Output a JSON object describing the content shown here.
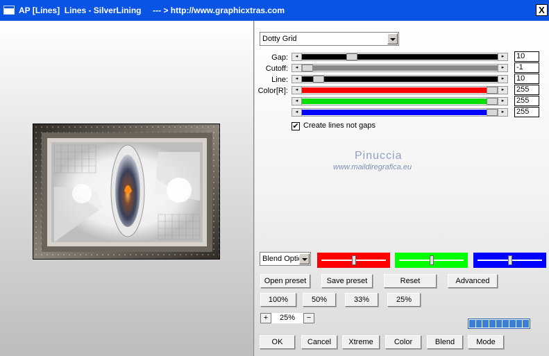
{
  "window": {
    "title": "AP [Lines]  Lines - SilverLining     --- > http://www.graphicxtras.com",
    "close_glyph": "X"
  },
  "preset_select": {
    "value": "Dotty Grid"
  },
  "sliders": [
    {
      "label": "Gap:",
      "value": "10",
      "fill": "#000000",
      "thumb_pos": 0.24
    },
    {
      "label": "Cutoff:",
      "value": "-1",
      "fill": "#888888",
      "thumb_pos": 0.0
    },
    {
      "label": "Line:",
      "value": "10",
      "fill": "#000000",
      "thumb_pos": 0.06
    },
    {
      "label": "Color[R]:",
      "value": "255",
      "fill": "#ff0000",
      "thumb_pos": 1.0
    },
    {
      "label": "",
      "value": "255",
      "fill": "#00e000",
      "thumb_pos": 1.0
    },
    {
      "label": "",
      "value": "255",
      "fill": "#0000ff",
      "thumb_pos": 1.0
    }
  ],
  "checkbox": {
    "label": "Create lines not gaps",
    "checked": true,
    "glyph": "✔"
  },
  "watermark": {
    "name": "Pinuccia",
    "url": "www.maildiregrafica.eu"
  },
  "blend_select": {
    "value": "Blend Optio"
  },
  "color_swatches": [
    {
      "color": "#ff0000",
      "knob": 0.5
    },
    {
      "color": "#00ff00",
      "knob": 0.5
    },
    {
      "color": "#0000ff",
      "knob": 0.5
    }
  ],
  "buttons": {
    "open_preset": "Open preset",
    "save_preset": "Save preset",
    "reset": "Reset",
    "advanced": "Advanced",
    "z100": "100%",
    "z50": "50%",
    "z33": "33%",
    "z25": "25%",
    "ok": "OK",
    "cancel": "Cancel",
    "xtreme": "Xtreme",
    "color": "Color",
    "blend": "Blend",
    "mode": "Mode"
  },
  "zoom": {
    "plus": "+",
    "minus": "−",
    "value": "25%"
  },
  "progress": {
    "segments": 9
  },
  "colors": {
    "titlebar": "#0a54e4"
  }
}
